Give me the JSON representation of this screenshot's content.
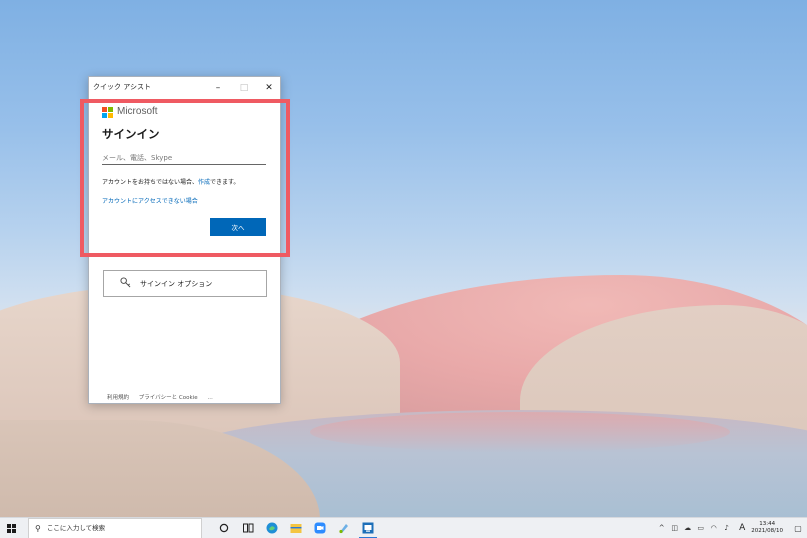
{
  "window": {
    "title": "クイック アシスト",
    "min": "–",
    "max": "□",
    "close": "✕"
  },
  "signin": {
    "brand": "Microsoft",
    "heading": "サインイン",
    "email_placeholder": "メール、電話、Skype",
    "email_value": "",
    "no_account_text": "アカウントをお持ちではない場合、",
    "create_link": "作成",
    "no_account_suffix": "できます。",
    "cant_access": "アカウントにアクセスできない場合",
    "next_button": "次へ"
  },
  "options": {
    "icon": "key-icon",
    "label": "サインイン オプション"
  },
  "footer": {
    "terms": "利用規約",
    "privacy": "プライバシーと Cookie",
    "more": "…"
  },
  "taskbar": {
    "search_placeholder": "ここに入力して検索",
    "ime": "A",
    "time": "13:44",
    "date": "2021/08/10"
  }
}
